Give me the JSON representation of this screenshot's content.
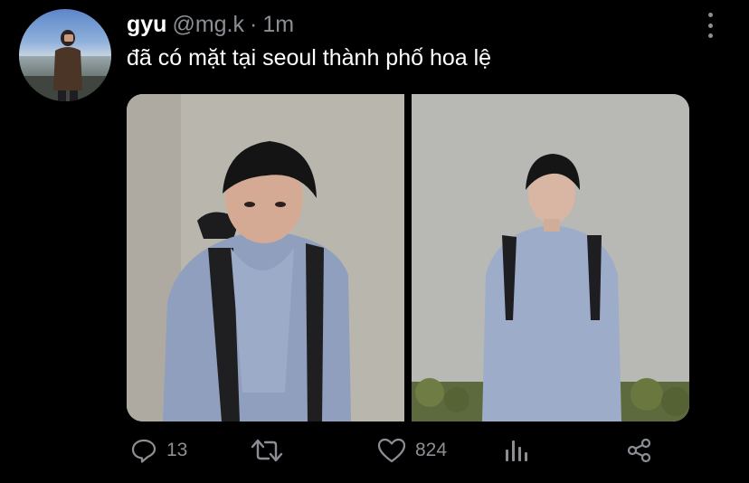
{
  "tweet": {
    "display_name": "gyu",
    "handle": "@mg.k",
    "separator": "·",
    "time": "1m",
    "text": "đã có mặt tại seoul thành phố hoa lệ"
  },
  "media": {
    "photos": [
      {
        "icon": "photo-close-up-icon"
      },
      {
        "icon": "photo-full-body-icon"
      }
    ]
  },
  "actions": {
    "reply_count": "13",
    "like_count": "824"
  },
  "colors": {
    "background": "#000000",
    "text": "#ffffff",
    "muted": "#8b8f94"
  }
}
